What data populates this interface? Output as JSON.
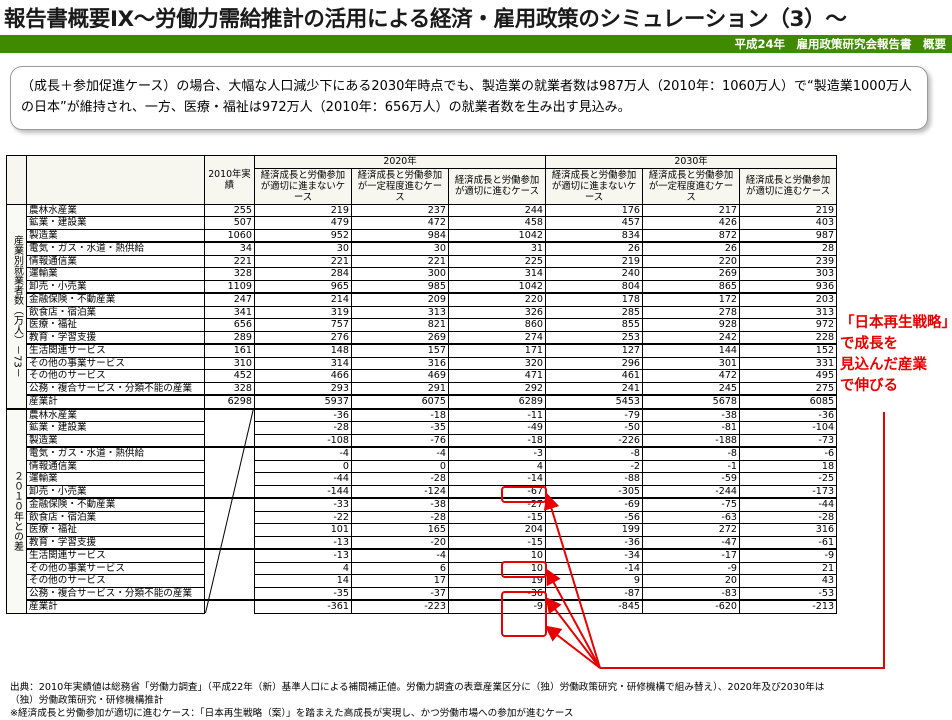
{
  "title": "報告書概要Ⅸ～労働力需給推計の活用による経済・雇用政策のシミュレーション（3）～",
  "subtitle": "平成24年　雇用政策研究会報告書　概要",
  "summary": "（成長＋参加促進ケース）の場合、大幅な人口減少下にある2030年時点でも、製造業の就業者数は987万人（2010年：1060万人）で“製造業1000万人の日本”が維持され、一方、医療・福祉は972万人（2010年：656万人）の就業者数を生み出す見込み。",
  "table": {
    "header_2010": "2010年実績",
    "year_2020": "2020年",
    "year_2030": "2030年",
    "case_headers": [
      "経済成長と労働参加が適切に進まないケース",
      "経済成長と労働参加が一定程度進むケース",
      "経済成長と労働参加が適切に進むケース"
    ],
    "axis_top": "産業別就業者数（万人）－73－",
    "axis_bottom": "２０１０年との差",
    "industries": [
      "農林水産業",
      "鉱業・建設業",
      "製造業",
      "電気・ガス・水道・熱供給",
      "情報通信業",
      "運輸業",
      "卸売・小売業",
      "金融保険・不動産業",
      "飲食店・宿泊業",
      "医療・福祉",
      "教育・学習支援",
      "生活関連サービス",
      "その他の事業サービス",
      "その他のサービス",
      "公務・複合サービス・分類不能の産業"
    ],
    "total_label": "産業計",
    "top_rows": [
      [
        255,
        219,
        237,
        244,
        176,
        217,
        219
      ],
      [
        507,
        479,
        472,
        458,
        457,
        426,
        403
      ],
      [
        1060,
        952,
        984,
        1042,
        834,
        872,
        987
      ],
      [
        34,
        30,
        30,
        31,
        26,
        26,
        28
      ],
      [
        221,
        221,
        221,
        225,
        219,
        220,
        239
      ],
      [
        328,
        284,
        300,
        314,
        240,
        269,
        303
      ],
      [
        1109,
        965,
        985,
        1042,
        804,
        865,
        936
      ],
      [
        247,
        214,
        209,
        220,
        178,
        172,
        203
      ],
      [
        341,
        319,
        313,
        326,
        285,
        278,
        313
      ],
      [
        656,
        757,
        821,
        860,
        855,
        928,
        972
      ],
      [
        289,
        276,
        269,
        274,
        253,
        242,
        228
      ],
      [
        161,
        148,
        157,
        171,
        127,
        144,
        152
      ],
      [
        310,
        314,
        316,
        320,
        296,
        301,
        331
      ],
      [
        452,
        466,
        469,
        471,
        461,
        472,
        495
      ],
      [
        328,
        293,
        291,
        292,
        241,
        245,
        275
      ]
    ],
    "top_total": [
      6298,
      5937,
      6075,
      6289,
      5453,
      5678,
      6085
    ],
    "bottom_rows": [
      [
        -36,
        -18,
        -11,
        -79,
        -38,
        -36
      ],
      [
        -28,
        -35,
        -49,
        -50,
        -81,
        -104
      ],
      [
        -108,
        -76,
        -18,
        -226,
        -188,
        -73
      ],
      [
        -4,
        -4,
        -3,
        -8,
        -8,
        -6
      ],
      [
        0,
        0,
        4,
        -2,
        -1,
        18
      ],
      [
        -44,
        -28,
        -14,
        -88,
        -59,
        -25
      ],
      [
        -144,
        -124,
        -67,
        -305,
        -244,
        -173
      ],
      [
        -33,
        -38,
        -27,
        -69,
        -75,
        -44
      ],
      [
        -22,
        -28,
        -15,
        -56,
        -63,
        -28
      ],
      [
        101,
        165,
        204,
        199,
        272,
        316
      ],
      [
        -13,
        -20,
        -15,
        -36,
        -47,
        -61
      ],
      [
        -13,
        -4,
        10,
        -34,
        -17,
        -9
      ],
      [
        4,
        6,
        10,
        -14,
        -9,
        21
      ],
      [
        14,
        17,
        19,
        9,
        20,
        43
      ],
      [
        -35,
        -37,
        -36,
        -87,
        -83,
        -53
      ]
    ],
    "bottom_total": [
      -361,
      -223,
      -9,
      -845,
      -620,
      -213
    ]
  },
  "annotation": [
    "「日本再生戦略」",
    "で成長を",
    "見込んだ産業",
    "で伸びる"
  ],
  "source": [
    "出典：2010年実績値は総務省「労働力調査」（平成22年（新）基準人口による補間補正値。労働力調査の表章産業区分に（独）労働政策研究・研修機構で組み替え）、2020年及び2030年は",
    "（独）労働政策研究・研修機構推計",
    "※経済成長と労働参加が適切に進むケース：「日本再生戦略（案）」を踏まえた高成長が実現し、かつ労働市場への参加が進むケース"
  ],
  "colors": {
    "green_bar": "#3f8a00",
    "annotation_red": "#e60000"
  }
}
